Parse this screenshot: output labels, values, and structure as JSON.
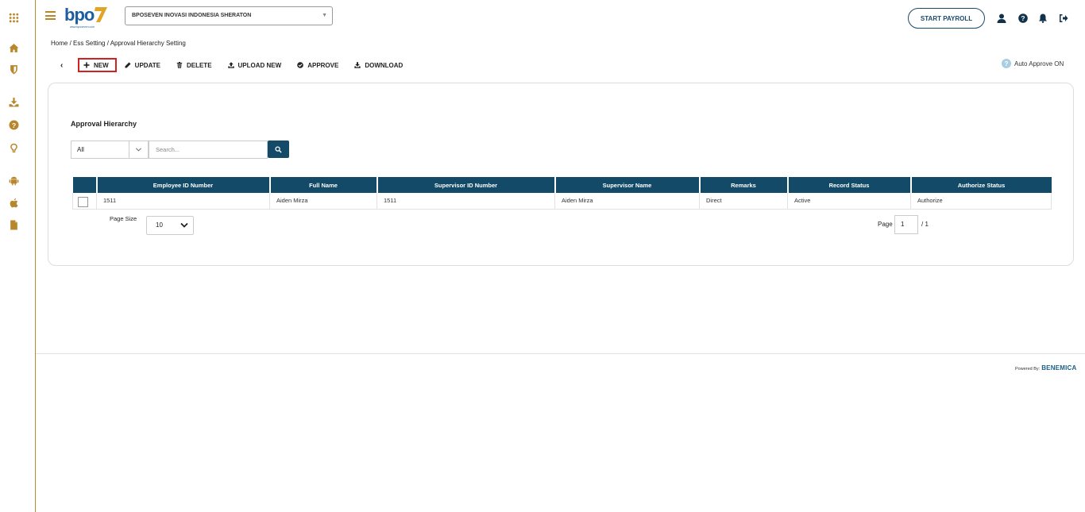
{
  "header": {
    "company": "BPOSEVEN INOVASI INDONESIA SHERATON",
    "start_payroll": "START PAYROLL",
    "logo_text": "bpo7",
    "logo_sub": "www.bposeven.com"
  },
  "sidebar": {
    "icons": [
      "apps-grid-icon",
      "home-icon",
      "shield-icon",
      "download-icon",
      "help-icon",
      "lightbulb-icon",
      "android-icon",
      "apple-icon",
      "file-icon"
    ]
  },
  "breadcrumb": "Home / Ess Setting / Approval Hierarchy Setting",
  "toolbar": {
    "back": "‹",
    "new": "NEW",
    "update": "UPDATE",
    "delete": "DELETE",
    "upload_new": "UPLOAD NEW",
    "approve": "APPROVE",
    "download": "DOWNLOAD"
  },
  "auto_approve": {
    "icon": "?",
    "label": "Auto Approve ON"
  },
  "card": {
    "title": "Approval Hierarchy",
    "filter_value": "All",
    "search_placeholder": "Search..."
  },
  "table": {
    "columns": [
      "Employee ID Number",
      "Full Name",
      "Supervisor ID Number",
      "Supervisor Name",
      "Remarks",
      "Record Status",
      "Authorize Status"
    ],
    "rows": [
      [
        "1511",
        "Aiden Mirza",
        "1511",
        "Aiden Mirza",
        "Direct",
        "Active",
        "Authorize"
      ]
    ]
  },
  "pagination": {
    "page_size_label": "Page Size",
    "page_size": "10",
    "page_label": "Page",
    "page": "1",
    "total": "/ 1"
  },
  "footer": {
    "powered_by": "Powered By:",
    "brand": "BENEMICA"
  },
  "colors": {
    "accent": "#b8862b",
    "primary": "#124a68",
    "highlight": "#d32020"
  }
}
